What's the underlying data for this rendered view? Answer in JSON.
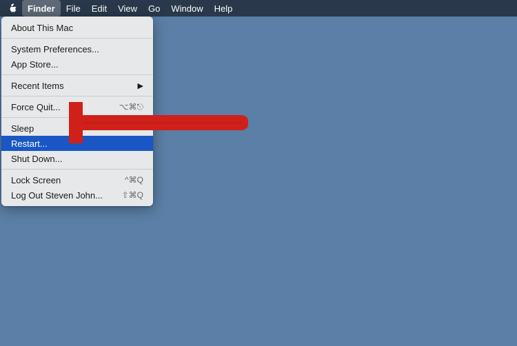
{
  "menubar": {
    "items": [
      "Finder",
      "File",
      "Edit",
      "View",
      "Go",
      "Window",
      "Help"
    ]
  },
  "menu": {
    "items": [
      {
        "id": "about",
        "label": "About This Mac",
        "shortcut": "",
        "separator_after": false
      },
      {
        "id": "sep1",
        "separator": true
      },
      {
        "id": "system-prefs",
        "label": "System Preferences...",
        "shortcut": "",
        "separator_after": false
      },
      {
        "id": "app-store",
        "label": "App Store...",
        "shortcut": "",
        "separator_after": false
      },
      {
        "id": "sep2",
        "separator": true
      },
      {
        "id": "recent-items",
        "label": "Recent Items",
        "shortcut": "",
        "arrow": "▶",
        "separator_after": false
      },
      {
        "id": "sep3",
        "separator": true
      },
      {
        "id": "force-quit",
        "label": "Force Quit...",
        "shortcut": "⌥⌘⎋",
        "separator_after": false
      },
      {
        "id": "sep4",
        "separator": true
      },
      {
        "id": "sleep",
        "label": "Sleep",
        "shortcut": "",
        "separator_after": false
      },
      {
        "id": "restart",
        "label": "Restart...",
        "shortcut": "",
        "separator_after": false,
        "highlighted": true
      },
      {
        "id": "shutdown",
        "label": "Shut Down...",
        "shortcut": "",
        "separator_after": false
      },
      {
        "id": "sep5",
        "separator": true
      },
      {
        "id": "lock-screen",
        "label": "Lock Screen",
        "shortcut": "^⌘Q",
        "separator_after": false
      },
      {
        "id": "logout",
        "label": "Log Out Steven John...",
        "shortcut": "⇧⌘Q",
        "separator_after": false
      }
    ]
  }
}
